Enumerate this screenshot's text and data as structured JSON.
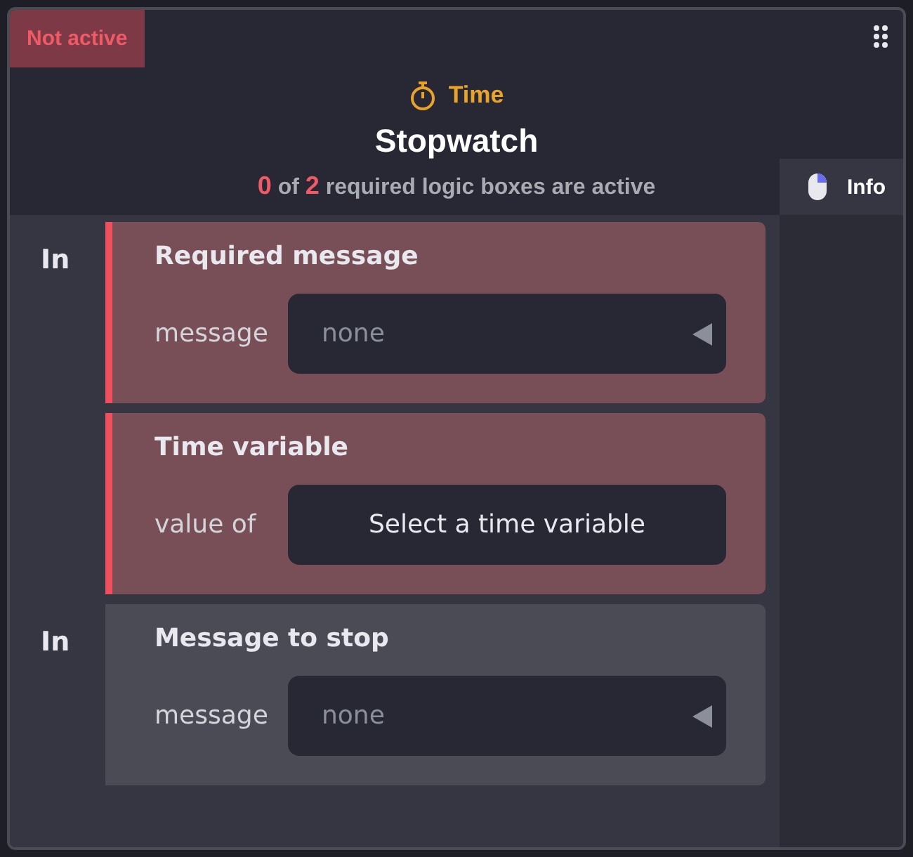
{
  "status_badge": "Not active",
  "category": "Time",
  "title": "Stopwatch",
  "requirement": {
    "active_count": "0",
    "joiner": "of",
    "required_count": "2",
    "text": "required logic boxes are active"
  },
  "info_tab": "Info",
  "blocks": [
    {
      "port": "In",
      "title": "Required message",
      "required": true,
      "field": {
        "label": "message",
        "kind": "dropdown",
        "placeholder": "none"
      }
    },
    {
      "title": "Time variable",
      "required": true,
      "field": {
        "label": "value of",
        "kind": "button",
        "value": "Select a time variable"
      }
    },
    {
      "port": "In",
      "title": "Message to stop",
      "required": false,
      "field": {
        "label": "message",
        "kind": "dropdown",
        "placeholder": "none"
      }
    }
  ]
}
